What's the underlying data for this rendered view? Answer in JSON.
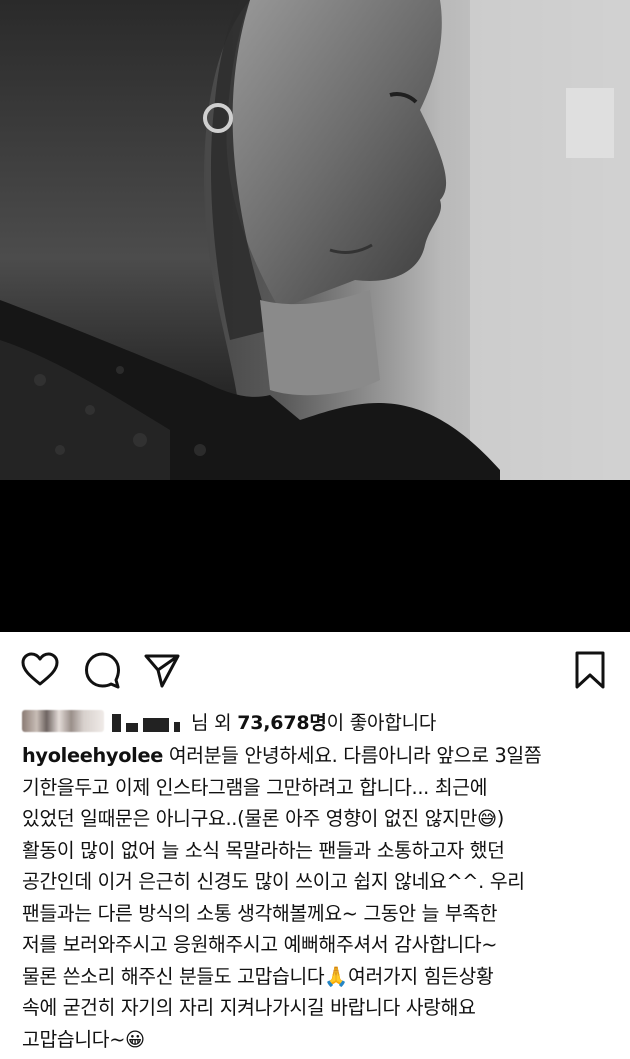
{
  "post": {
    "username": "hyoleehyolee",
    "likes_suffix": "님 외",
    "likes_count": "73,678명",
    "likes_tail": "이 좋아합니다",
    "caption_first": "여러분들 안녕하세요. 다름아니라 앞으로 3일쯤",
    "caption_lines": [
      "기한을두고 이제 인스타그램을 그만하려고 합니다... 최근에",
      "있었던 일때문은 아니구요..(물론 아주 영향이 없진 않지만😅)",
      "활동이 많이 없어 늘 소식 목말라하는 팬들과 소통하고자 했던",
      "공간인데  이거 은근히 신경도 많이 쓰이고 쉽지 않네요^^. 우리",
      "팬들과는 다른 방식의 소통 생각해볼께요~ 그동안 늘 부족한",
      "저를 보러와주시고 응원해주시고 예뻐해주셔서 감사합니다~",
      "물론 쓴소리 해주신 분들도 고맙습니다🙏여러가지 힘든상황",
      "속에 굳건히 자기의 자리 지켜나가시길 바랍니다 사랑해요",
      "고맙습니다~😀"
    ]
  },
  "icons": {
    "like": "heart-icon",
    "comment": "comment-icon",
    "share": "paper-plane-icon",
    "save": "bookmark-icon"
  },
  "colors": {
    "text": "#111111",
    "background": "#ffffff",
    "photo_bar": "#000000"
  }
}
